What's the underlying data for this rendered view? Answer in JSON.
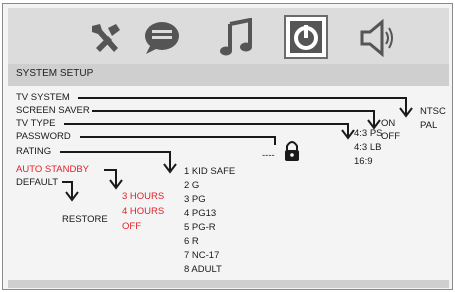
{
  "header": {
    "title": "SYSTEM SETUP"
  },
  "icons": [
    "wrench-icon",
    "speech-bubble-icon",
    "music-note-icon",
    "system-setup-icon",
    "speaker-icon"
  ],
  "menu": {
    "tv_system": "TV SYSTEM",
    "screen_saver": "SCREEN SAVER",
    "tv_type": "TV TYPE",
    "password": "PASSWORD",
    "rating": "RATING",
    "auto_standby": "AUTO STANDBY",
    "default": "DEFAULT"
  },
  "options": {
    "tv_system": [
      "NTSC",
      "PAL"
    ],
    "screen_saver": [
      "ON",
      "OFF"
    ],
    "tv_type": [
      "4:3 PS",
      "4:3 LB",
      "16:9"
    ],
    "password_field": "----",
    "rating": [
      "1 KID SAFE",
      "2 G",
      "3 PG",
      "4 PG13",
      "5 PG-R",
      "6 R",
      "7 NC-17",
      "8 ADULT"
    ],
    "auto_standby": [
      "3 HOURS",
      "4 HOURS",
      "OFF"
    ],
    "default": "RESTORE"
  },
  "colors": {
    "highlight": "#e0222a",
    "text": "#1a1a1a",
    "bar": "#cfcfcf"
  }
}
